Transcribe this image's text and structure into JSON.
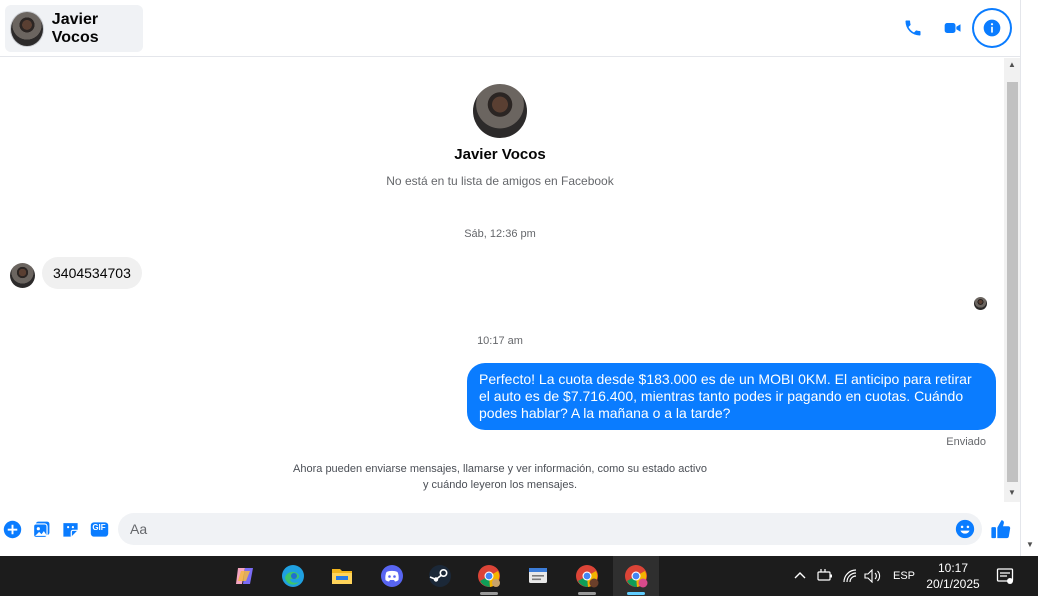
{
  "header": {
    "contact_name": "Javier Vocos",
    "icons": [
      "phone-icon",
      "video-camera-icon",
      "info-icon"
    ]
  },
  "intro": {
    "name": "Javier Vocos",
    "subtitle": "No está en tu lista de amigos en Facebook"
  },
  "messages": [
    {
      "type": "timestamp",
      "text": "Sáb, 12:36 pm"
    },
    {
      "type": "incoming",
      "text": "3404534703"
    },
    {
      "type": "timestamp",
      "text": "10:17 am"
    },
    {
      "type": "outgoing",
      "text": "Perfecto! La cuota desde $183.000 es de un MOBI 0KM. El anticipo para retirar el auto es de $7.716.400, mientras tanto podes ir pagando en cuotas. Cuándo podes hablar? A la mañana o a la tarde?",
      "status": "Enviado"
    }
  ],
  "notice": "Ahora pueden enviarse mensajes, llamarse y ver información, como su estado activo y cuándo leyeron los mensajes.",
  "composer": {
    "placeholder": "Aa",
    "icons": [
      "plus-icon",
      "image-icon",
      "sticker-icon",
      "gif-icon",
      "emoji-icon",
      "like-icon"
    ],
    "gif_label": "GIF"
  },
  "taskbar": {
    "apps": [
      "copilot-icon",
      "edge-icon",
      "file-explorer-icon",
      "discord-icon",
      "steam-icon",
      "chrome-icon",
      "window-app-icon",
      "chrome-c-icon",
      "chrome-profile-icon"
    ],
    "language": "ESP",
    "time": "10:17",
    "date": "20/1/2025"
  },
  "colors": {
    "accent": "#0a7cff",
    "taskbar": "#1c1c1c",
    "bubble_in": "#f0f0f0"
  }
}
